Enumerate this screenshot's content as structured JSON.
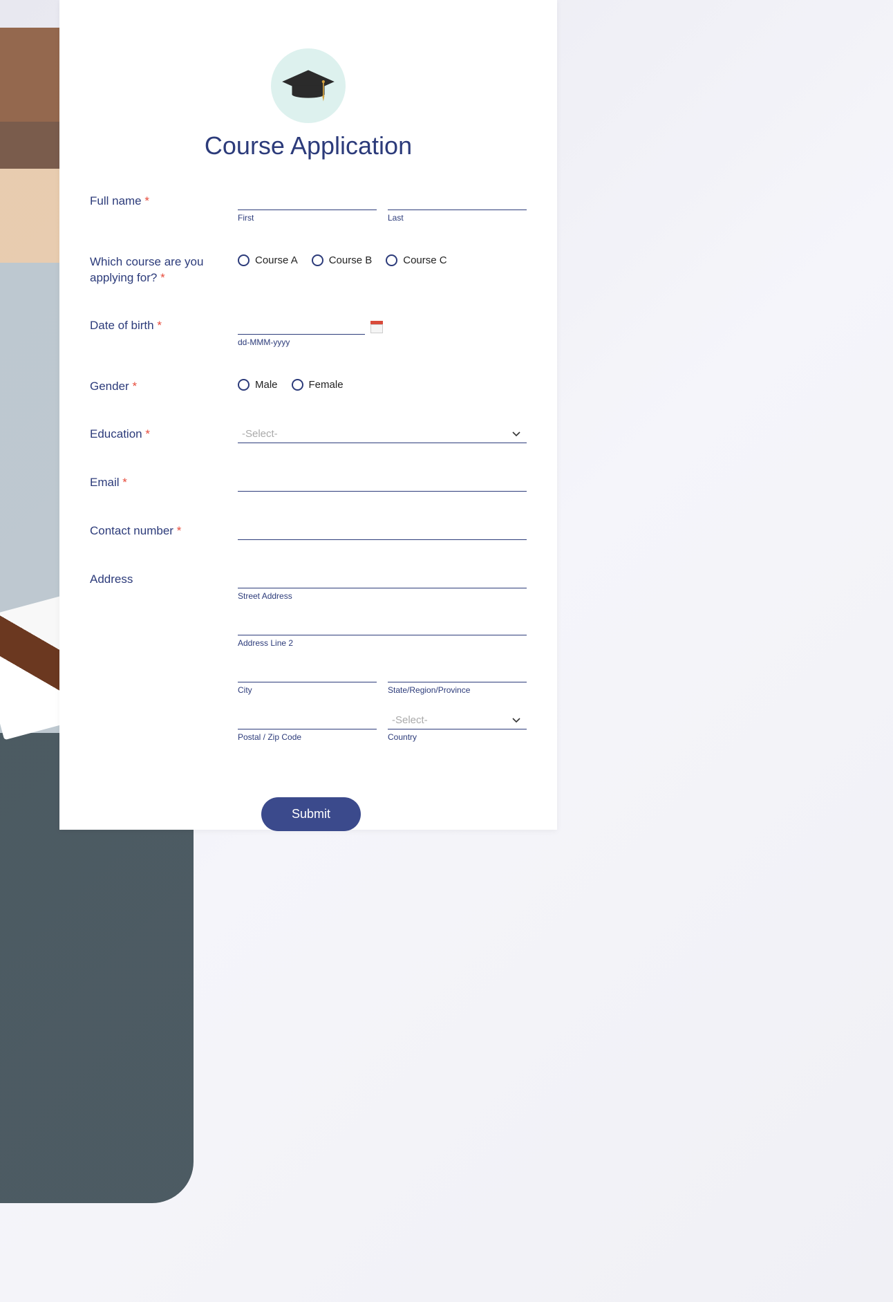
{
  "header": {
    "title": "Course Application"
  },
  "fields": {
    "fullname": {
      "label": "Full name",
      "first_sub": "First",
      "last_sub": "Last"
    },
    "course": {
      "label": "Which course are you applying for?",
      "options": [
        "Course A",
        "Course B",
        "Course C"
      ]
    },
    "dob": {
      "label": "Date of birth",
      "format_hint": "dd-MMM-yyyy"
    },
    "gender": {
      "label": "Gender",
      "options": [
        "Male",
        "Female"
      ]
    },
    "education": {
      "label": "Education",
      "placeholder": "-Select-"
    },
    "email": {
      "label": "Email"
    },
    "contact": {
      "label": "Contact number"
    },
    "address": {
      "label": "Address",
      "street_sub": "Street Address",
      "line2_sub": "Address Line 2",
      "city_sub": "City",
      "region_sub": "State/Region/Province",
      "postal_sub": "Postal / Zip Code",
      "country_sub": "Country",
      "country_placeholder": "-Select-"
    }
  },
  "buttons": {
    "submit": "Submit"
  },
  "required_marker": "*"
}
